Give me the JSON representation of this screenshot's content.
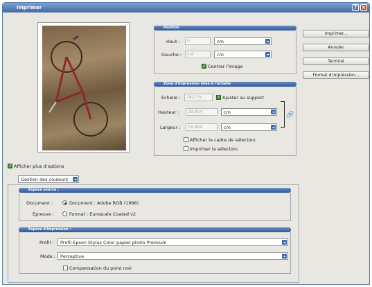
{
  "window": {
    "title": "Imprimer",
    "help": "?",
    "close": "×"
  },
  "position": {
    "header": "Position",
    "haut_label": "Haut :",
    "haut_value": "0",
    "haut_unit": "cm",
    "gauche_label": "Gauche :",
    "gauche_value": "0,6",
    "gauche_unit": "cm",
    "center_label": "Centrer l'image"
  },
  "scale": {
    "header": "Zone d'impression mise à l'échelle",
    "echelle_label": "Echelle :",
    "echelle_value": "78,07%",
    "fit_label": "Ajuster au support",
    "hauteur_label": "Hauteur :",
    "hauteur_value": "28,854",
    "hauteur_unit": "cm",
    "largeur_label": "Largeur :",
    "largeur_value": "18,889",
    "largeur_unit": "cm",
    "show_box_label": "Afficher le cadre de sélection",
    "print_sel_label": "Imprimer la sélection"
  },
  "buttons": {
    "print": "Imprimer...",
    "cancel": "Annuler",
    "done": "Terminé",
    "page_setup": "Format d'impression..."
  },
  "more_options_label": "Afficher plus d'options",
  "mode_select": "Gestion des couleurs",
  "source": {
    "header": "Espace source :",
    "document_label": "Document :",
    "document_option": "Document : Adobe RGB (1998)",
    "proof_label": "Epreuve :",
    "proof_option": "Format : Euroscale Coated v2"
  },
  "print_space": {
    "header": "Espace d'impression :",
    "profile_label": "Profil :",
    "profile_value": "Profil Epson Stylus Color papier photo Premium",
    "mode_label": "Mode :",
    "mode_value": "Perceptive",
    "bpc_label": "Compensation du point noir"
  }
}
